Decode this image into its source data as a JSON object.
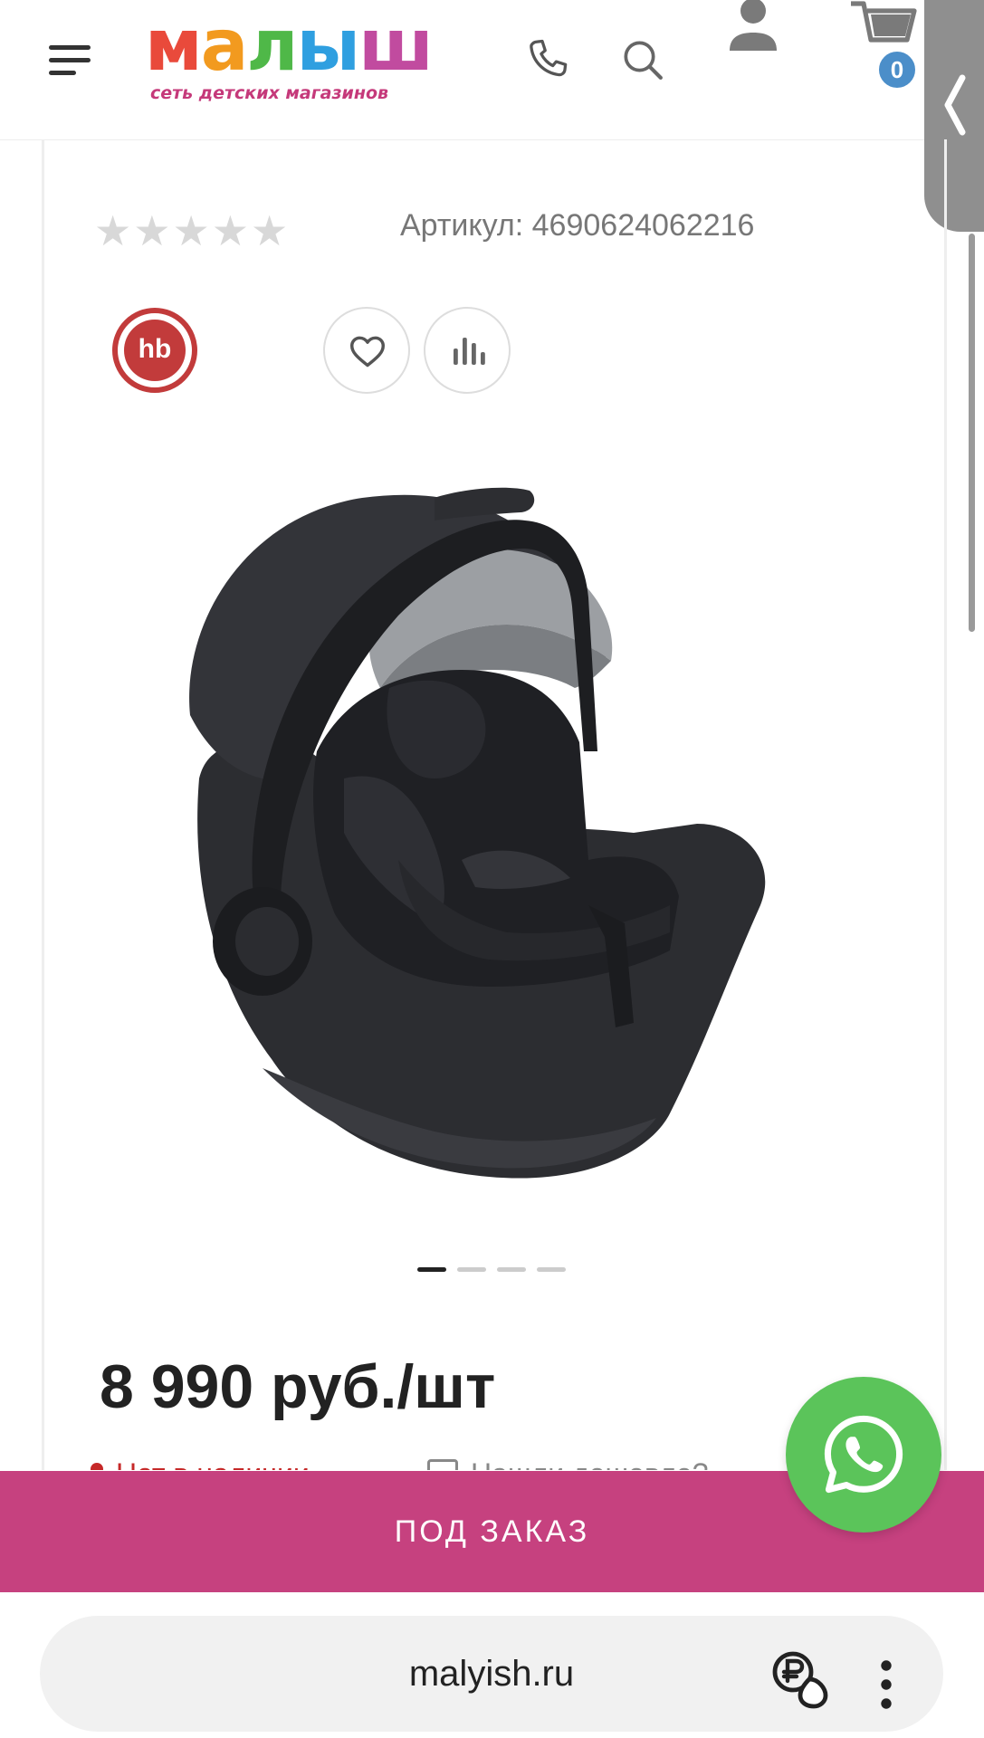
{
  "header": {
    "logo_text_letters": [
      "м",
      "а",
      "л",
      "ы",
      "ш"
    ],
    "logo_subtitle": "сеть детских магазинов",
    "cart_count": "0"
  },
  "product": {
    "rating_stars": "★★★★★",
    "sku_label": "Артикул: 4690624062216",
    "brand_logo": "hb",
    "price": "8 990 руб./шт",
    "availability_partial": "Нет в наличии",
    "cheaper_partial": "Нашли дешевле?",
    "gallery_slides": 4,
    "gallery_active_index": 0
  },
  "actions": {
    "order_button": "ПОД ЗАКАЗ"
  },
  "browser": {
    "url": "malyish.ru"
  },
  "icons": {
    "menu": "hamburger-icon",
    "phone": "phone-icon",
    "search": "search-icon",
    "user": "user-icon",
    "cart": "cart-icon",
    "favorite": "heart-icon",
    "compare": "compare-icon",
    "whatsapp": "whatsapp-icon",
    "tab_extension": "ruble-icon",
    "more": "more-vert-icon"
  },
  "colors": {
    "order_bar": "#c6417f",
    "whatsapp": "#5bc45a",
    "brand_red": "#c23b3b",
    "cart_badge": "#4b8ec9"
  }
}
